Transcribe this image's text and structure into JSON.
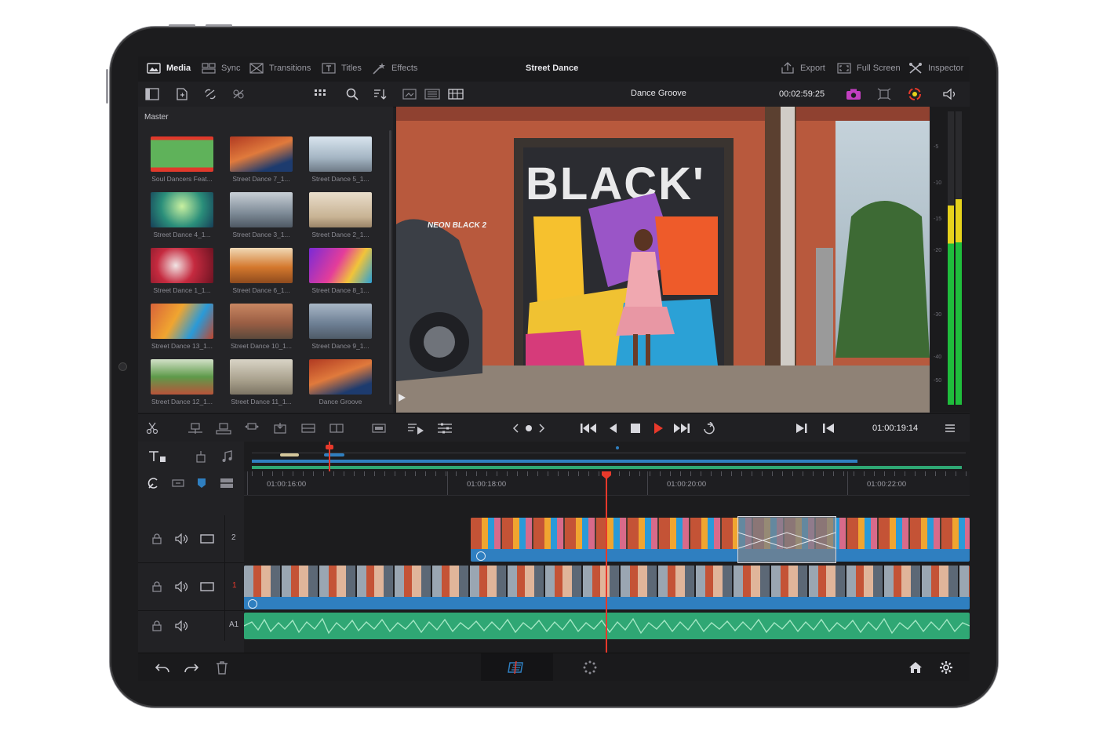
{
  "topbar": {
    "tabs": [
      {
        "label": "Media",
        "icon": "media-icon",
        "active": true
      },
      {
        "label": "Sync",
        "icon": "sync-icon",
        "active": false
      },
      {
        "label": "Transitions",
        "icon": "transitions-icon",
        "active": false
      },
      {
        "label": "Titles",
        "icon": "titles-icon",
        "active": false
      },
      {
        "label": "Effects",
        "icon": "effects-icon",
        "active": false
      }
    ],
    "project_title": "Street Dance",
    "right": [
      {
        "label": "Export",
        "icon": "export-icon"
      },
      {
        "label": "Full Screen",
        "icon": "fullscreen-icon"
      },
      {
        "label": "Inspector",
        "icon": "inspector-icon"
      }
    ]
  },
  "viewer": {
    "clip_name": "Dance Groove",
    "source_timecode": "00:02:59:25",
    "graffiti_text": "NEON BLACK 2"
  },
  "media_pool": {
    "bin": "Master",
    "clips": [
      {
        "label": "Soul Dancers Feat..."
      },
      {
        "label": "Street Dance 7_1..."
      },
      {
        "label": "Street Dance 5_1..."
      },
      {
        "label": "Street Dance 4_1..."
      },
      {
        "label": "Street Dance 3_1..."
      },
      {
        "label": "Street Dance 2_1..."
      },
      {
        "label": "Street Dance 1_1..."
      },
      {
        "label": "Street Dance 6_1..."
      },
      {
        "label": "Street Dance 8_1..."
      },
      {
        "label": "Street Dance 13_1..."
      },
      {
        "label": "Street Dance 10_1..."
      },
      {
        "label": "Street Dance 9_1..."
      },
      {
        "label": "Street Dance 12_1..."
      },
      {
        "label": "Street Dance 11_1..."
      },
      {
        "label": "Dance Groove"
      }
    ]
  },
  "audio_meter": {
    "scale": [
      "-5",
      "-10",
      "-15",
      "-20",
      "-30",
      "-40",
      "-50"
    ],
    "level_left": 0.68,
    "level_right": 0.7
  },
  "transport": {
    "record_timecode": "01:00:19:14"
  },
  "timeline": {
    "ruler": [
      "01:00:16:00",
      "01:00:18:00",
      "01:00:20:00",
      "01:00:22:00"
    ],
    "tracks": [
      {
        "label": "2"
      },
      {
        "label": "1"
      },
      {
        "label": "A1"
      }
    ]
  },
  "colors": {
    "accent_red": "#e8392b",
    "clip_blue": "#2f7fc0",
    "audio_green": "#2fa774",
    "meter_green": "#1fbd3c",
    "meter_yellow": "#e6d21c"
  }
}
